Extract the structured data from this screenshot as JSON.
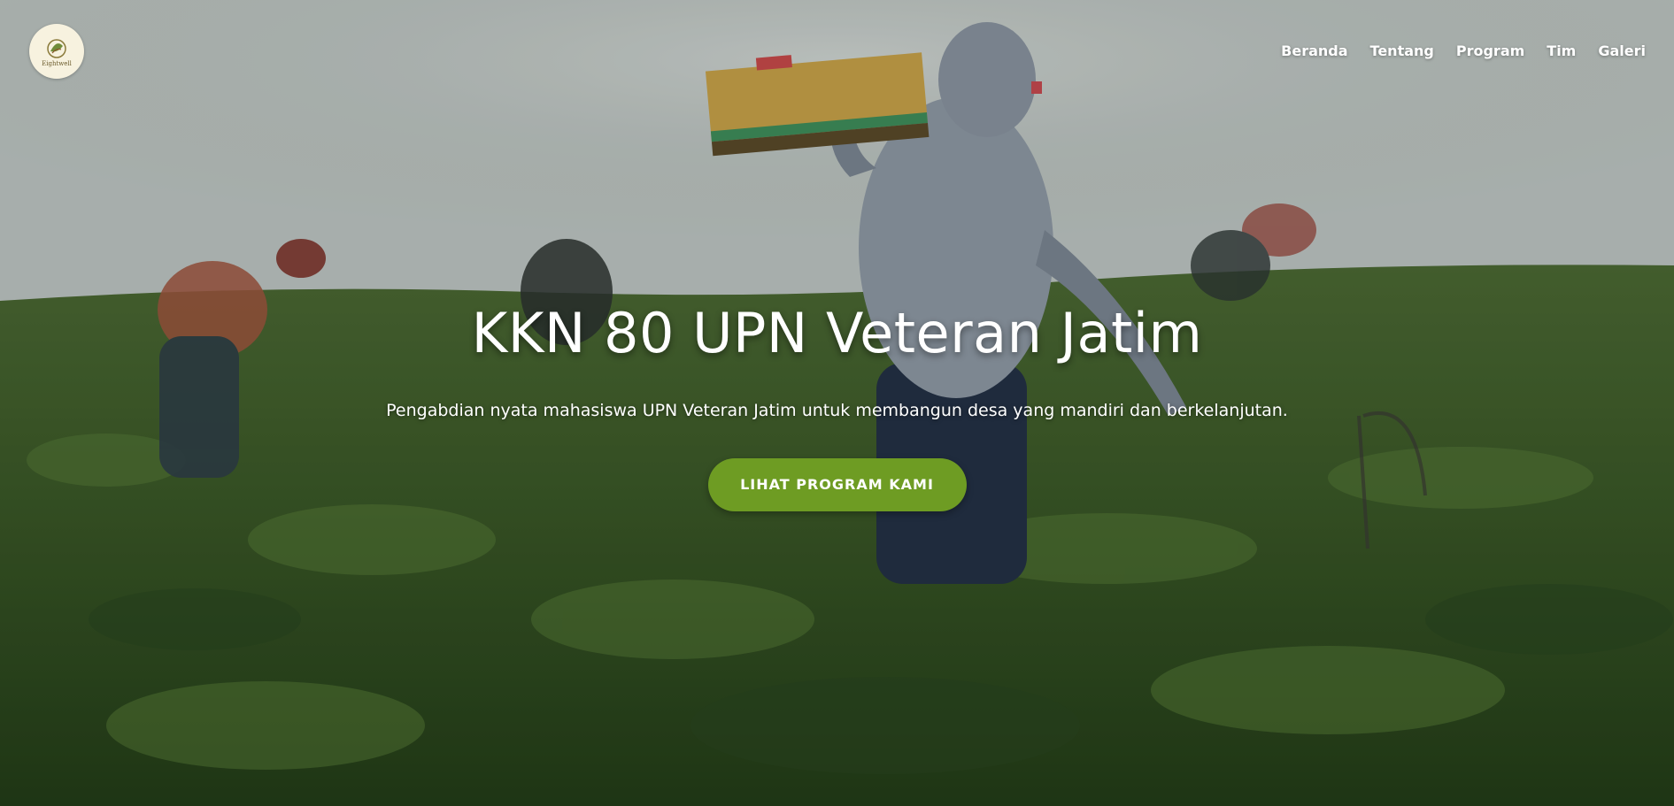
{
  "nav": {
    "logo_text": "Eightwell",
    "links": [
      "Beranda",
      "Tentang",
      "Program",
      "Tim",
      "Galeri"
    ]
  },
  "hero": {
    "title": "KKN 80 UPN Veteran Jatim",
    "subtitle": "Pengabdian nyata mahasiswa UPN Veteran Jatim untuk membangun desa yang mandiri dan berkelanjutan.",
    "cta_label": "LIHAT PROGRAM KAMI"
  },
  "colors": {
    "accent": "#6e9c23",
    "nav_text": "#ffffff"
  }
}
